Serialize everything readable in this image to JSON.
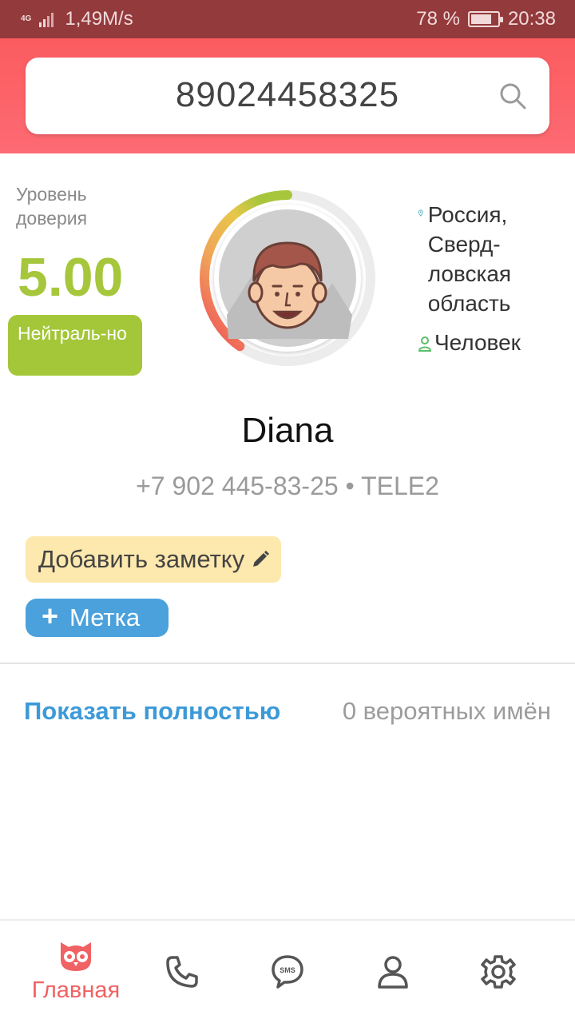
{
  "status_bar": {
    "network": "4G",
    "speed": "1,49M/s",
    "battery_percent": "78 %",
    "battery_level": 0.78,
    "time": "20:38"
  },
  "search": {
    "query": "89024458325",
    "icon": "search-icon"
  },
  "trust": {
    "label": "Уровень доверия",
    "score": "5.00",
    "badge": "Нейтраль-но",
    "gauge_level": 0.5
  },
  "location": {
    "region": "Россия, Сверд-ловская область",
    "type": "Человек"
  },
  "contact": {
    "name": "Diana",
    "phone_line": "+7 902 445-83-25 • TELE2"
  },
  "actions": {
    "add_note": "Добавить заметку",
    "tag": "Метка"
  },
  "names": {
    "show_full": "Показать полностью",
    "count_text": "0 вероятных имён"
  },
  "nav": {
    "home_label": "Главная",
    "items": [
      "owl-home-icon",
      "phone-icon",
      "sms-icon",
      "person-icon",
      "gear-icon"
    ]
  },
  "colors": {
    "header": "#fb5c5f",
    "status_bar": "#933a3c",
    "trust_green": "#a6c63b",
    "note_yellow": "#fde8ad",
    "tag_blue": "#4aa1dc",
    "link_blue": "#3d9ad8",
    "nav_active": "#f06263"
  }
}
